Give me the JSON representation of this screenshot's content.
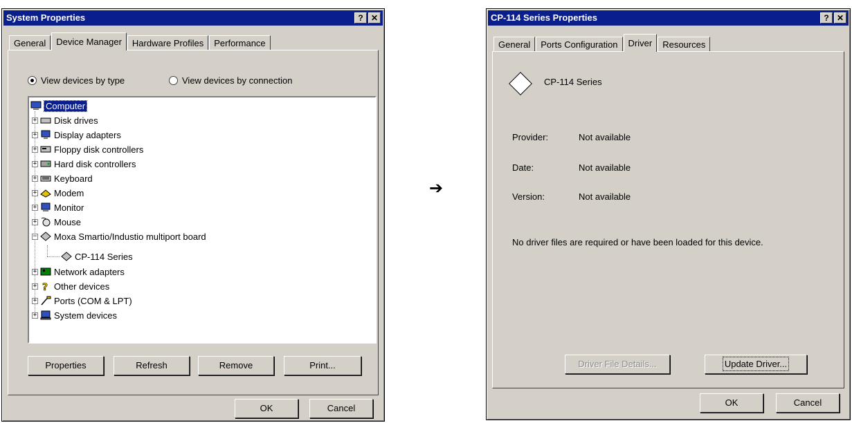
{
  "left_window": {
    "title": "System Properties",
    "help_btn": "?",
    "close_btn": "✕",
    "tabs": [
      "General",
      "Device Manager",
      "Hardware Profiles",
      "Performance"
    ],
    "radio_by_type": "View devices by type",
    "radio_by_connection": "View devices by connection",
    "tree": [
      {
        "label": "Computer",
        "icon": "computer-icon"
      },
      {
        "label": "Disk drives",
        "icon": "disk-drive-icon"
      },
      {
        "label": "Display adapters",
        "icon": "display-adapter-icon"
      },
      {
        "label": "Floppy disk controllers",
        "icon": "floppy-controller-icon"
      },
      {
        "label": "Hard disk controllers",
        "icon": "hard-disk-controller-icon"
      },
      {
        "label": "Keyboard",
        "icon": "keyboard-icon"
      },
      {
        "label": "Modem",
        "icon": "modem-icon"
      },
      {
        "label": "Monitor",
        "icon": "monitor-icon"
      },
      {
        "label": "Mouse",
        "icon": "mouse-icon"
      },
      {
        "label": "Moxa Smartio/Industio multiport board",
        "icon": "multiport-board-icon"
      },
      {
        "label": "CP-114 Series",
        "icon": "multiport-board-icon"
      },
      {
        "label": "Network adapters",
        "icon": "network-adapter-icon"
      },
      {
        "label": "Other devices",
        "icon": "unknown-device-icon"
      },
      {
        "label": "Ports (COM & LPT)",
        "icon": "port-icon"
      },
      {
        "label": "System devices",
        "icon": "system-device-icon"
      }
    ],
    "buttons": {
      "properties": "Properties",
      "refresh": "Refresh",
      "remove": "Remove",
      "print": "Print...",
      "ok": "OK",
      "cancel": "Cancel"
    }
  },
  "arrow": "➔",
  "right_window": {
    "title": "CP-114 Series Properties",
    "help_btn": "?",
    "close_btn": "✕",
    "tabs": [
      "General",
      "Ports Configuration",
      "Driver",
      "Resources"
    ],
    "device_name": "CP-114 Series",
    "provider_label": "Provider:",
    "provider_value": "Not available",
    "date_label": "Date:",
    "date_value": "Not available",
    "version_label": "Version:",
    "version_value": "Not available",
    "message": "No driver files are required or have been loaded for this device.",
    "buttons": {
      "driver_file_details": "Driver File Details...",
      "update_driver": "Update Driver...",
      "ok": "OK",
      "cancel": "Cancel"
    }
  },
  "colors": {
    "titlebar": "#0a1e8c",
    "face": "#d4d0c8"
  }
}
